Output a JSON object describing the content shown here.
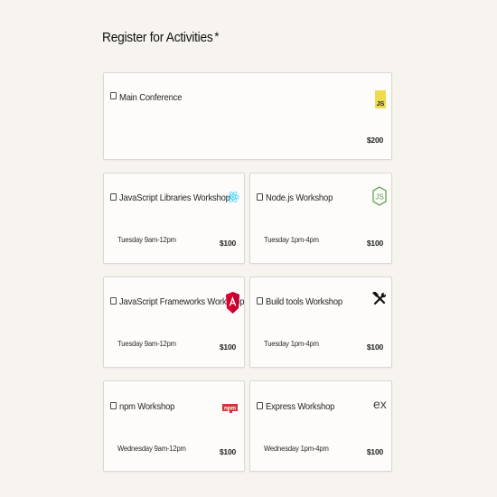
{
  "form": {
    "title": "Register for Activities",
    "required_mark": "*"
  },
  "activities": [
    {
      "name": "Main Conference",
      "time": "",
      "price": "$200",
      "icon": "javascript-icon",
      "icon_color": "#f0db4f"
    },
    {
      "name": "JavaScript Libraries Workshop",
      "time": "Tuesday 9am-12pm",
      "price": "$100",
      "icon": "react-icon",
      "icon_color": "#61dafb"
    },
    {
      "name": "Node.js Workshop",
      "time": "Tuesday 1pm-4pm",
      "price": "$100",
      "icon": "nodejs-icon",
      "icon_color": "#539e43"
    },
    {
      "name": "JavaScript Frameworks Workshop",
      "time": "Tuesday 9am-12pm",
      "price": "$100",
      "icon": "angular-icon",
      "icon_color": "#dd0031"
    },
    {
      "name": "Build tools Workshop",
      "time": "Tuesday 1pm-4pm",
      "price": "$100",
      "icon": "tools-icon",
      "icon_color": "#111111"
    },
    {
      "name": "npm Workshop",
      "time": "Wednesday 9am-12pm",
      "price": "$100",
      "icon": "npm-icon",
      "icon_color": "#cb3837"
    },
    {
      "name": "Express Workshop",
      "time": "Wednesday 1pm-4pm",
      "price": "$100",
      "icon": "express-icon",
      "icon_color": "#444444"
    }
  ]
}
